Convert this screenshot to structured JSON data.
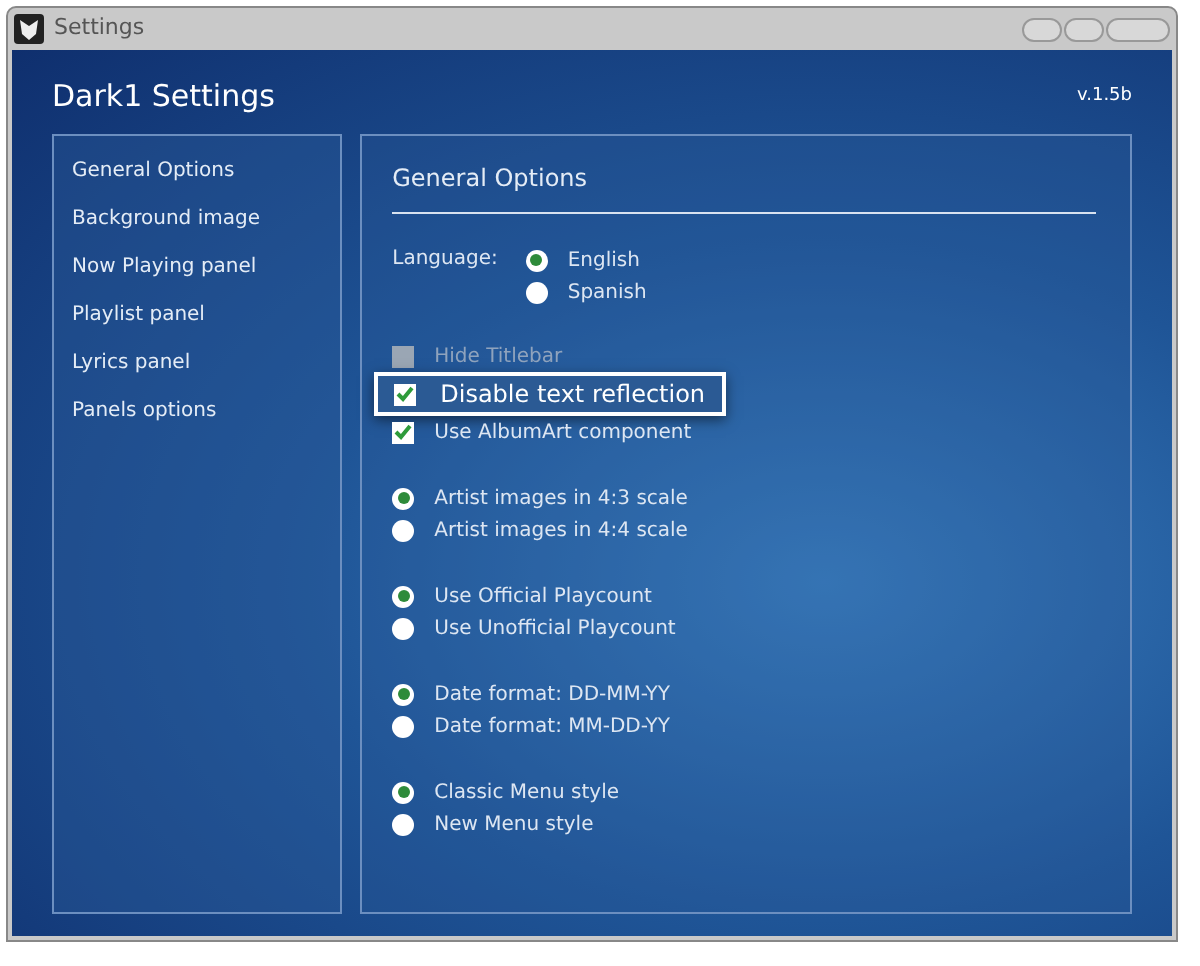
{
  "window": {
    "title": "Settings"
  },
  "header": {
    "title": "Dark1 Settings",
    "version": "v.1.5b"
  },
  "sidebar": {
    "items": [
      {
        "label": "General Options"
      },
      {
        "label": "Background image"
      },
      {
        "label": "Now Playing panel"
      },
      {
        "label": "Playlist panel"
      },
      {
        "label": "Lyrics panel"
      },
      {
        "label": "Panels options"
      }
    ]
  },
  "panel": {
    "title": "General Options",
    "language": {
      "label": "Language:",
      "options": [
        {
          "label": "English",
          "selected": true
        },
        {
          "label": "Spanish",
          "selected": false
        }
      ]
    },
    "checkboxes": [
      {
        "label": "Hide Titlebar",
        "checked": false,
        "disabled": true,
        "focused": false
      },
      {
        "label": "Disable text reflection",
        "checked": true,
        "disabled": false,
        "focused": true
      },
      {
        "label": "Use AlbumArt component",
        "checked": true,
        "disabled": false,
        "focused": false
      }
    ],
    "radio_groups": [
      [
        {
          "label": "Artist images in 4:3 scale",
          "selected": true
        },
        {
          "label": "Artist images in 4:4 scale",
          "selected": false
        }
      ],
      [
        {
          "label": "Use Official Playcount",
          "selected": true
        },
        {
          "label": "Use Unofficial Playcount",
          "selected": false
        }
      ],
      [
        {
          "label": "Date format: DD-MM-YY",
          "selected": true
        },
        {
          "label": "Date format: MM-DD-YY",
          "selected": false
        }
      ],
      [
        {
          "label": "Classic Menu style",
          "selected": true
        },
        {
          "label": "New Menu style",
          "selected": false
        }
      ]
    ]
  }
}
